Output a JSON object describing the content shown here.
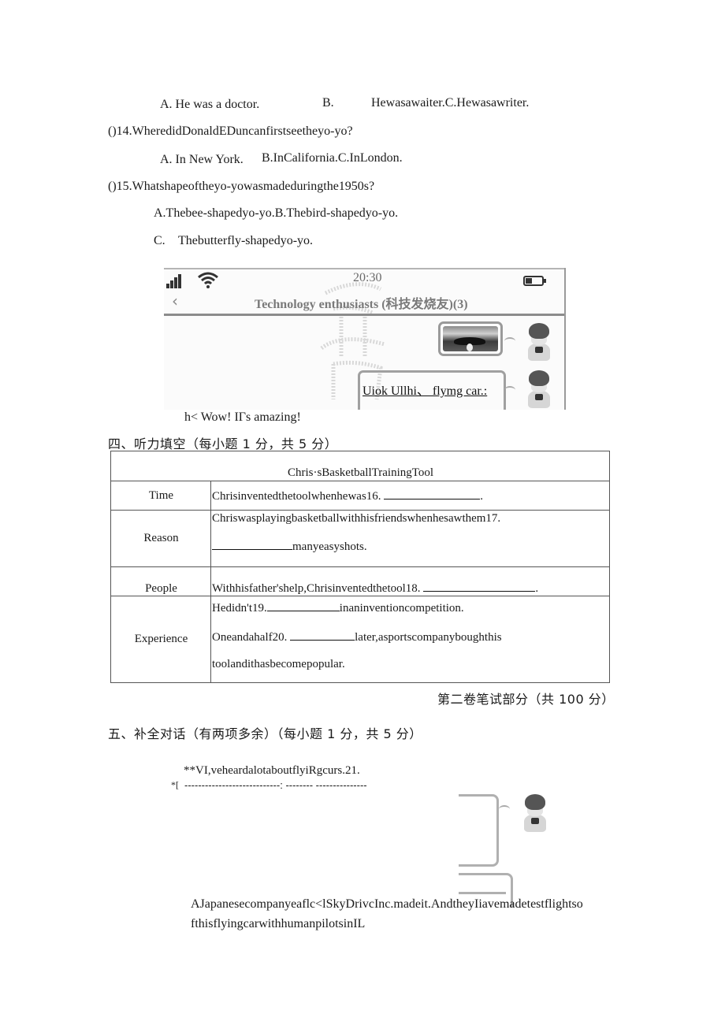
{
  "questions": {
    "q13_options": {
      "a": "A. He was a doctor.",
      "b_label": "B.",
      "b_c": "Hewasawaiter.C.Hewasawriter."
    },
    "q14": {
      "stem": "()14.WheredidDonaldEDuncanfirstseetheyo-yo?",
      "a": "A. In New York.",
      "b_c": "B.InCalifornia.C.InLondon."
    },
    "q15": {
      "stem": "()15.Whatshapeoftheyo-yowasmadeduringthe1950s?",
      "a_b": "A.Thebee-shapedyo-yo.B.Thebird-shapedyo-yo.",
      "c_label": "C.",
      "c": "Thebutterfly-shapedyo-yo."
    }
  },
  "chat_screenshot": {
    "status_time": "20:30",
    "signal_icon": "signal-bars-icon",
    "wifi_icon": "wifi-icon",
    "battery_icon": "battery-icon",
    "battery_level": 0.4,
    "back_icon": "‹",
    "chat_title": "Technology enthusiasts (科技发烧友)(3)",
    "messages": [
      {
        "type": "image",
        "sender": "avatar-boy"
      },
      {
        "type": "text",
        "sender": "avatar-boy",
        "text": "Uiok Ullhi、 flymg car.:"
      }
    ],
    "reply_line": "h< Wow! IΓs amazing!"
  },
  "section4": {
    "heading": "四、听力填空（每小题 1 分，共 5 分）",
    "table": {
      "title": "Chris·sBasketballTrainingTool",
      "rows": [
        {
          "label": "Time",
          "lines": [
            {
              "before": "Chrisinventedthetoolwhenhewas16. ",
              "after": "."
            }
          ]
        },
        {
          "label": "Reason",
          "lines": [
            {
              "text": "Chriswasplayingbasketballwithhisfriendswhenhesawthem17."
            },
            {
              "before": "",
              "after": "manyeasyshots."
            }
          ]
        },
        {
          "label": "People",
          "lines": [
            {
              "before": "Withhisfather'shelp,Chrisinventedthetool18. ",
              "after": "."
            }
          ]
        },
        {
          "label": "Experience",
          "lines": [
            {
              "before": "Hedidn't19.",
              "after": "inaninventioncompetition."
            },
            {
              "before": "Oneandahalf20. ",
              "after": "later,asportscompanyboughthis"
            },
            {
              "text": "toolandithasbecomepopular."
            }
          ]
        }
      ]
    }
  },
  "part2_note": "第二卷笔试部分（共 100 分）",
  "section5": {
    "heading": "五、补全对话（有两项多余）（每小题 1 分，共 5 分）",
    "line1": "**VI,veheardalotaboutflyiRgcurs.21.",
    "line2_prefix": "*[",
    "line2_dashes": "----------------------------:   -------- ---------------",
    "answer_line1": "AJapanesecompanyeaflc<lSkyDrivcInc.madeit.AndtheyIiavemadetestflightso",
    "answer_line2": "fthisflyingcarwithhumanpilotsinIL"
  }
}
